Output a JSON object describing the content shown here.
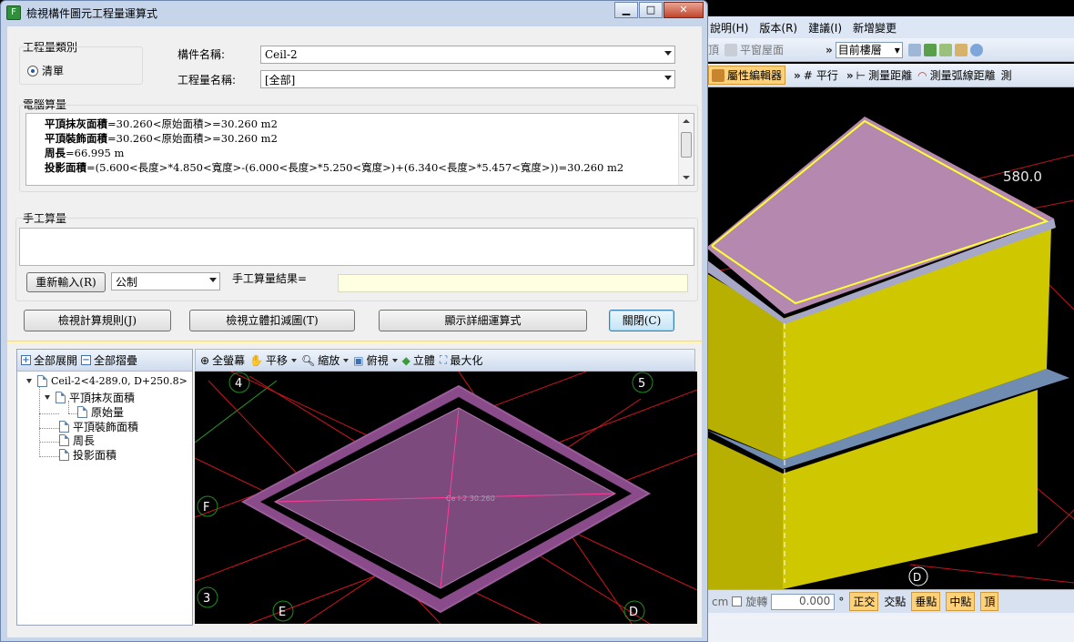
{
  "app": {
    "menu": [
      "說明(H)",
      "版本(R)",
      "建議(I)",
      "新增變更"
    ],
    "toolbar1": {
      "item1": "頂",
      "item2": "平窗屋面",
      "floor_combo": "目前樓層"
    },
    "toolbar2": {
      "prop_editor": "屬性編輯器",
      "parallel": "平行",
      "measure_distance": "測量距離",
      "measure_arc": "測量弧線距離",
      "measure_more": "測"
    },
    "viewport": {
      "dimension_label": "580.0",
      "axis_label": "D"
    },
    "statusbar": {
      "unit": "cm",
      "rotate_label": "旋轉",
      "rotate_value": "0.000",
      "degree": "°",
      "ortho": "正交",
      "intersect": "交點",
      "perpendicular": "垂點",
      "midpoint": "中點",
      "vertex": "頂"
    }
  },
  "dialog": {
    "title": "檢視構件圖元工程量運算式",
    "quantity_type": {
      "label": "工程量類別",
      "option": "清單"
    },
    "component_name": {
      "label": "構件名稱:",
      "value": "Ceil-2"
    },
    "quantity_name": {
      "label": "工程量名稱:",
      "value": "[全部]"
    },
    "computed": {
      "label": "電腦算量",
      "lines": [
        {
          "name": "平頂抹灰面積",
          "expr": "=30.260<原始面積>=30.260 m2"
        },
        {
          "name": "平頂裝飾面積",
          "expr": "=30.260<原始面積>=30.260 m2"
        },
        {
          "name": "周長",
          "expr": "=66.995 m"
        },
        {
          "name": "投影面積",
          "expr": "=(5.600<長度>*4.850<寬度>-(6.000<長度>*5.250<寬度>)+(6.340<長度>*5.457<寬度>))=30.260 m2"
        }
      ]
    },
    "manual": {
      "label": "手工算量",
      "reenter_button": "重新輸入(R)",
      "unit_combo": "公制",
      "result_label": "手工算量結果="
    },
    "buttons": {
      "view_rules": "檢視計算規則(J)",
      "view_3d": "檢視立體扣減圖(T)",
      "show_detail": "顯示詳細運算式",
      "close": "關閉(C)"
    },
    "tree": {
      "expand_all": "全部展開",
      "collapse_all": "全部摺疊",
      "root": "Ceil-2<4-289.0, D+250.8>",
      "children": [
        "平頂抹灰面積",
        "原始量",
        "平頂裝飾面積",
        "周長",
        "投影面積"
      ]
    },
    "viewer": {
      "toolbar": [
        "全螢幕",
        "平移",
        "縮放",
        "俯視",
        "立體",
        "最大化"
      ],
      "axis_labels": [
        "4",
        "5",
        "F",
        "3",
        "E",
        "D"
      ],
      "center_label": "Ce l-2 30.260"
    }
  }
}
